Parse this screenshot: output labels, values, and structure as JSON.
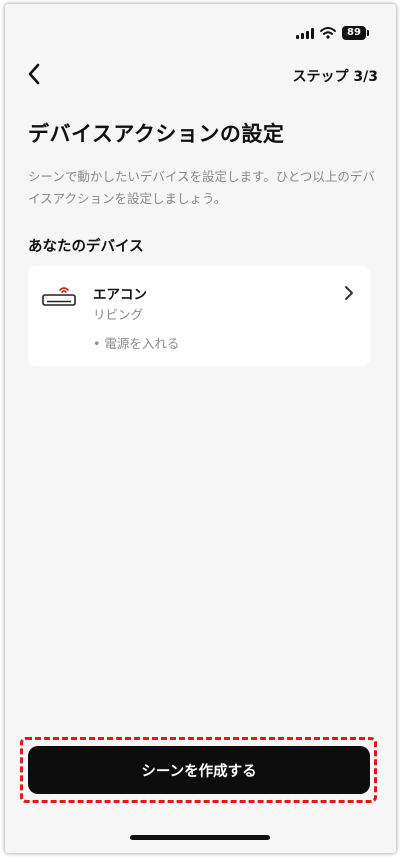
{
  "status_bar": {
    "battery": "89"
  },
  "header": {
    "step": "ステップ 3/3"
  },
  "page": {
    "title": "デバイスアクションの設定",
    "description": "シーンで動かしたいデバイスを設定します。ひとつ以上のデバイスアクションを設定しましょう。"
  },
  "devices": {
    "section_title": "あなたのデバイス",
    "items": [
      {
        "name": "エアコン",
        "room": "リビング",
        "action": "• 電源を入れる",
        "icon": "air-conditioner-icon"
      }
    ]
  },
  "footer": {
    "create_label": "シーンを作成する"
  },
  "colors": {
    "background": "#f6f6f6",
    "card": "#ffffff",
    "primary_button": "#0d0d0d",
    "highlight": "#e01919",
    "muted_text": "#8a8a8a"
  }
}
